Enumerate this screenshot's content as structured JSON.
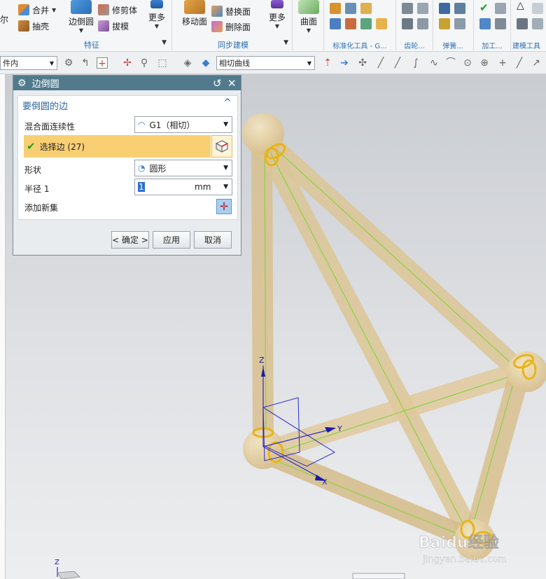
{
  "ribbon": {
    "groups": [
      {
        "label": "特征",
        "items": [
          "合并",
          "抽壳",
          "边倒圆",
          "修剪体",
          "拔模",
          "更多"
        ]
      },
      {
        "label": "同步建模",
        "items": [
          "移动面",
          "替换面",
          "删除面",
          "更多"
        ]
      },
      {
        "label": "曲面",
        "items": [
          "曲面"
        ]
      },
      {
        "label": "标准化工具 - G...",
        "items": []
      },
      {
        "label": "齿轮...",
        "items": []
      },
      {
        "label": "弹簧...",
        "items": []
      },
      {
        "label": "加工...",
        "items": []
      },
      {
        "label": "建模工具",
        "items": []
      }
    ],
    "left_cut_text": "尔"
  },
  "selection_bar": {
    "scope_value": "件内",
    "curve_rule_value": "相切曲线"
  },
  "dialog": {
    "title": "边倒圆",
    "section_title": "要倒圆的边",
    "continuity_label": "混合面连续性",
    "continuity_value": "G1（相切）",
    "select_edge_label": "选择边 (27)",
    "shape_label": "形状",
    "shape_value": "圆形",
    "radius_label": "半径 1",
    "radius_value": "1",
    "radius_unit": "mm",
    "add_set_label": "添加新集",
    "ok_label": "< 确定 >",
    "apply_label": "应用",
    "cancel_label": "取消"
  },
  "viewport": {
    "axis_z": "Z",
    "axis_y": "Y",
    "axis_x": "X",
    "corner_axis_z": "Z"
  },
  "watermark": {
    "brand": "Baidu经验",
    "url": "jingyan.baidu.com"
  },
  "colors": {
    "dialog_title_bg": "#517b8d",
    "selected_row_bg": "#f9cf74",
    "section_title": "#2a66a8",
    "tube": "#e4cc9a",
    "edge_highlight": "#8fd14a",
    "fillet_marker": "#e8b418"
  }
}
